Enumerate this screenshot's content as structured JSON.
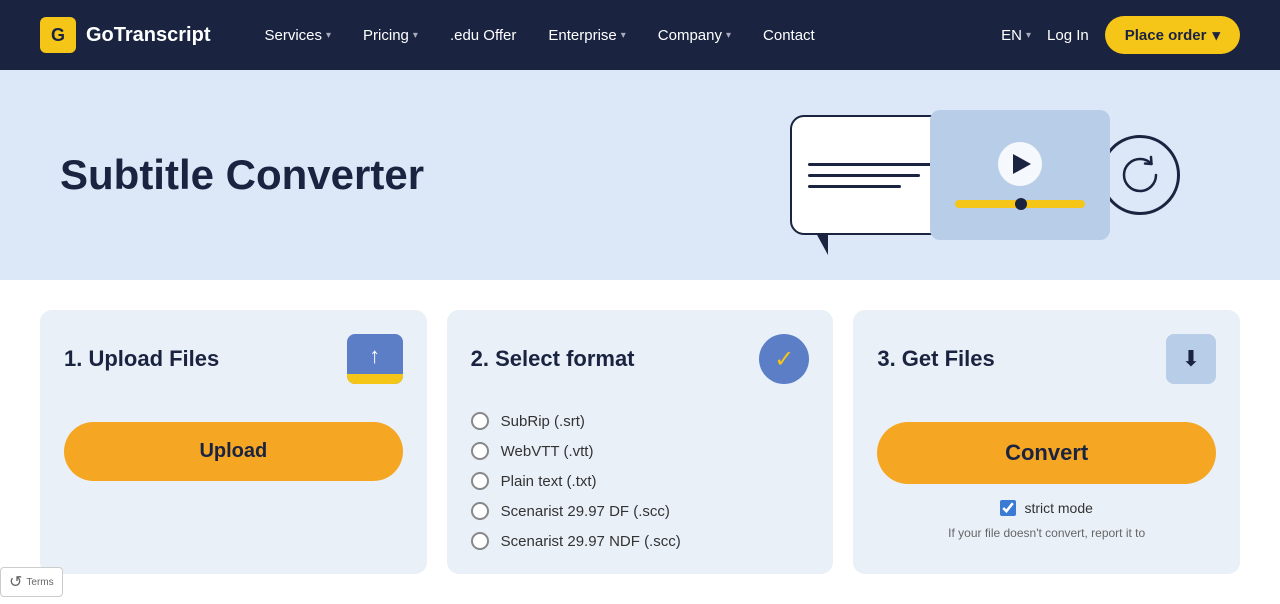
{
  "nav": {
    "logo_letter": "G",
    "logo_text": "GoTranscript",
    "links": [
      {
        "label": "Services",
        "has_dropdown": true
      },
      {
        "label": "Pricing",
        "has_dropdown": true
      },
      {
        "label": ".edu Offer",
        "has_dropdown": false
      },
      {
        "label": "Enterprise",
        "has_dropdown": true
      },
      {
        "label": "Company",
        "has_dropdown": true
      },
      {
        "label": "Contact",
        "has_dropdown": false
      }
    ],
    "lang": "EN",
    "login_label": "Log In",
    "place_order_label": "Place order"
  },
  "hero": {
    "title": "Subtitle Converter"
  },
  "upload_card": {
    "title": "1. Upload Files",
    "button_label": "Upload"
  },
  "format_card": {
    "title": "2. Select format",
    "formats": [
      "SubRip (.srt)",
      "WebVTT (.vtt)",
      "Plain text (.txt)",
      "Scenarist 29.97 DF (.scc)",
      "Scenarist 29.97 NDF (.scc)"
    ]
  },
  "get_files_card": {
    "title": "3. Get Files",
    "convert_label": "Convert",
    "strict_mode_label": "strict mode",
    "note": "If your file doesn't convert, report it to"
  },
  "recaptcha": {
    "icon": "↺",
    "label": "Terms"
  }
}
